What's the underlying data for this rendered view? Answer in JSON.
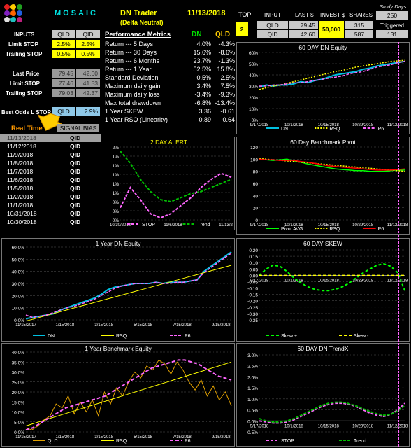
{
  "header": {
    "brand": "MOSAIC",
    "title": "DN Trader",
    "subtitle": "(Delta Neutral)",
    "date": "11/13/2018",
    "top_label": "TOP",
    "top_value": "2",
    "input_label": "INPUT",
    "last_label": "LAST $",
    "invest_label": "INVEST $",
    "shares_label": "SHARES",
    "study_days_label": "Study Days",
    "study_days_value": "250",
    "triggered_label": "Triggered",
    "triggered_value": "131",
    "row1": {
      "symbol": "QLD",
      "last": "79.45",
      "invest": "50,000",
      "shares": "315"
    },
    "row2": {
      "symbol": "QID",
      "last": "42.60",
      "shares": "587"
    }
  },
  "inputs": {
    "title": "INPUTS",
    "col1": "QLD",
    "col2": "QID",
    "rows": [
      {
        "label": "Limit STOP",
        "v1": "2.5%",
        "v2": "2.5%"
      },
      {
        "label": "Trailing STOP",
        "v1": "0.5%",
        "v2": "0.5%"
      },
      {
        "label": "Last Price",
        "v1": "79.45",
        "v2": "42.60"
      },
      {
        "label": "Limit STOP",
        "v1": "77.46",
        "v2": "41.53"
      },
      {
        "label": "Trailing STOP",
        "v1": "79.03",
        "v2": "42.37"
      }
    ],
    "best_odds_label": "Best Odds L STOP",
    "best_odds_symbol": "QLD",
    "best_odds_value": "2.9%",
    "realtime_label": "Real Time",
    "signal_bias_label": "SIGNAL BIAS"
  },
  "performance": {
    "title": "Performance Metrics",
    "col1": "DN",
    "col2": "QLD",
    "rows": [
      {
        "label": "Return --- 5 Days",
        "dn": "4.0%",
        "qld": "-4.3%"
      },
      {
        "label": "Return --- 30 Days",
        "dn": "15.6%",
        "qld": "-8.6%"
      },
      {
        "label": "Return --- 6 Months",
        "dn": "23.7%",
        "qld": "-1.3%"
      },
      {
        "label": "Return --- 1 Year",
        "dn": "52.5%",
        "qld": "15.8%"
      },
      {
        "label": "Standard Deviation",
        "dn": "0.5%",
        "qld": "2.5%"
      },
      {
        "label": "Maximum daily gain",
        "dn": "3.4%",
        "qld": "7.5%"
      },
      {
        "label": "Maximum daily loss",
        "dn": "-3.4%",
        "qld": "-9.3%"
      },
      {
        "label": "Max total drawdown",
        "dn": "-6.8%",
        "qld": "-13.4%"
      },
      {
        "label": "1 Year SKEW",
        "dn": "3.36",
        "qld": "-0.61"
      },
      {
        "label": "1 Year RSQ  (Linearity)",
        "dn": "0.89",
        "qld": "0.64"
      }
    ]
  },
  "history": [
    {
      "date": "11/13/2018",
      "sym": "QID"
    },
    {
      "date": "11/12/2018",
      "sym": "QID"
    },
    {
      "date": "11/9/2018",
      "sym": "QID"
    },
    {
      "date": "11/8/2018",
      "sym": "QID"
    },
    {
      "date": "11/7/2018",
      "sym": "QID"
    },
    {
      "date": "11/6/2018",
      "sym": "QID"
    },
    {
      "date": "11/5/2018",
      "sym": "QID"
    },
    {
      "date": "11/2/2018",
      "sym": "QID"
    },
    {
      "date": "11/1/2018",
      "sym": "QID"
    },
    {
      "date": "10/31/2018",
      "sym": "QID"
    },
    {
      "date": "10/30/2018",
      "sym": "QID"
    }
  ],
  "colors": {
    "green": "#00ff00",
    "cyan": "#00c0e0",
    "dark_green": "#00c000",
    "yellow": "#ffff00",
    "magenta": "#ff66ff",
    "red": "#ff0000",
    "orange": "#e0a000"
  },
  "chart_data": [
    {
      "type": "line",
      "title": "60 DAY DN  Equity",
      "ylim": [
        0,
        60
      ],
      "yticks": [
        "0%",
        "10%",
        "20%",
        "30%",
        "40%",
        "50%",
        "60%"
      ],
      "xticks": [
        "9/17/2018",
        "10/1/2018",
        "10/15/2018",
        "10/29/2018",
        "11/12/2018"
      ],
      "legend": [
        "DN",
        "RSQ",
        "P6"
      ],
      "series": [
        {
          "name": "DN",
          "values": [
            29,
            31,
            30,
            31,
            31,
            32,
            34,
            33,
            35,
            36,
            38,
            40,
            41,
            42,
            43,
            45,
            46,
            48,
            49,
            50,
            51,
            52
          ]
        },
        {
          "name": "RSQ",
          "values": [
            27,
            28.5,
            30,
            31,
            32.5,
            34,
            35.5,
            37,
            38.5,
            40,
            41.5,
            43,
            44,
            45.5,
            47,
            48,
            49,
            50,
            51,
            52,
            52.5,
            53
          ]
        },
        {
          "name": "P6",
          "values": [
            30,
            30,
            31,
            31,
            32,
            33,
            33,
            34,
            35,
            36,
            37,
            38,
            39,
            41,
            42,
            43,
            45,
            47,
            48,
            49,
            51,
            52
          ]
        }
      ]
    },
    {
      "type": "line",
      "title": "2 DAY ALERT",
      "ylim": [
        0,
        1.8
      ],
      "yticks": [
        "0%",
        "0%",
        "0%",
        "1%",
        "1%",
        "1%",
        "1%",
        "1%",
        "2%"
      ],
      "xticks": [
        "10/30/2018",
        "11/6/2018",
        "11/13/2"
      ],
      "legend": [
        "STOP",
        "Trend"
      ],
      "series": [
        {
          "name": "Trend",
          "values": [
            1.7,
            1.4,
            1.0,
            0.7,
            0.5,
            0.45,
            0.55,
            0.65,
            0.7,
            0.8,
            0.9,
            1.0
          ]
        },
        {
          "name": "STOP",
          "values": [
            0.3,
            0.8,
            0.5,
            0.15,
            0.05,
            0.15,
            0.35,
            0.55,
            0.8,
            1.0,
            1.15,
            1.05
          ]
        }
      ]
    },
    {
      "type": "line",
      "title": "60  Day  Benchmark Pivot",
      "ylim": [
        0,
        120
      ],
      "yticks": [
        "0",
        "20",
        "40",
        "60",
        "80",
        "100",
        "120"
      ],
      "xticks": [
        "9/17/2018",
        "10/1/2018",
        "10/15/2018",
        "10/29/2018",
        "11/12/2018"
      ],
      "legend": [
        "Pivot AVG",
        "RSQ",
        "P6"
      ],
      "series": [
        {
          "name": "Pivot AVG",
          "values": [
            100,
            99,
            98,
            99,
            100,
            97,
            95,
            92,
            90,
            88,
            86,
            84,
            83,
            82,
            81,
            81,
            80,
            80,
            80,
            81,
            82,
            82
          ]
        },
        {
          "name": "RSQ",
          "values": [
            101,
            100,
            99,
            98,
            97,
            96,
            95,
            94,
            93,
            92,
            91,
            90,
            89,
            88,
            87,
            86,
            85,
            84,
            83,
            82,
            81,
            80
          ]
        },
        {
          "name": "P6",
          "values": [
            100,
            99,
            99,
            98,
            98,
            98,
            96,
            95,
            93,
            91,
            89,
            88,
            87,
            86,
            85,
            84,
            83,
            82,
            82,
            82,
            83,
            84
          ]
        }
      ]
    },
    {
      "type": "line",
      "title": "1 Year  DN   Equity",
      "ylim": [
        0,
        60
      ],
      "yticks": [
        "0.0%",
        "10.0%",
        "20.0%",
        "30.0%",
        "40.0%",
        "50.0%",
        "60.0%"
      ],
      "xticks": [
        "11/15/2017",
        "1/15/2018",
        "3/15/2018",
        "5/15/2018",
        "7/15/2018",
        "9/15/2018"
      ],
      "legend": [
        "DN",
        "RSQ",
        "P6"
      ],
      "series": [
        {
          "name": "DN",
          "values": [
            1,
            2,
            3,
            4,
            5,
            8,
            10,
            12,
            14,
            16,
            18,
            21,
            25,
            27,
            28,
            29,
            30,
            30,
            30,
            31,
            30,
            31,
            31,
            31,
            32,
            33,
            40,
            44,
            48,
            52,
            56
          ]
        },
        {
          "name": "RSQ",
          "values": [
            -1,
            1,
            3,
            5,
            7,
            9,
            11,
            13,
            15,
            17,
            19,
            21,
            23,
            25,
            27,
            29,
            31,
            33,
            35,
            37,
            39,
            41,
            43,
            45
          ]
        },
        {
          "name": "P6",
          "values": [
            4,
            2,
            3,
            4,
            6,
            8,
            10,
            11,
            13,
            15,
            17,
            20,
            23,
            26,
            28,
            29,
            30,
            30,
            30,
            31,
            30,
            30,
            31,
            31,
            32,
            33,
            39,
            43,
            47,
            51,
            55
          ]
        }
      ]
    },
    {
      "type": "line",
      "title": "60  DAY  SKEW",
      "ylim": [
        -0.35,
        0.2
      ],
      "yticks": [
        "-0.35",
        "-0.30",
        "-0.25",
        "-0.20",
        "-0.15",
        "-0.10",
        "-0.05",
        "0.00",
        "0.05",
        "0.10",
        "0.15",
        "0.20"
      ],
      "xticks": [
        "9/17/2018",
        "10/1/2018",
        "10/15/2018",
        "10/29/2018",
        "11/12/2018"
      ],
      "legend": [
        "Skew +",
        "Skew -"
      ],
      "series": [
        {
          "name": "Skew +",
          "values": [
            0,
            0.05,
            0.08,
            0.07,
            0.03,
            -0.02,
            -0.06,
            -0.09,
            -0.11,
            -0.12,
            -0.12,
            -0.11,
            -0.09,
            -0.06,
            -0.02,
            0.02,
            0.05,
            0.08,
            0.09,
            0.07,
            0.02,
            -0.12
          ]
        },
        {
          "name": "Skew -",
          "values": [
            0,
            0,
            0,
            0,
            0,
            0,
            0,
            0,
            0,
            0,
            0,
            0,
            0,
            0,
            0,
            0,
            0,
            0,
            0,
            0,
            0,
            0
          ]
        }
      ]
    },
    {
      "type": "line",
      "title": "1 Year  Benchmark Equity",
      "ylim": [
        0,
        40
      ],
      "yticks": [
        "0.0%",
        "5.0%",
        "10.0%",
        "15.0%",
        "20.0%",
        "25.0%",
        "30.0%",
        "35.0%",
        "40.0%"
      ],
      "xticks": [
        "11/15/2017",
        "1/15/2018",
        "3/15/2018",
        "5/15/2018",
        "7/15/2018",
        "9/15/2018"
      ],
      "legend": [
        "QLD",
        "RSQ",
        "P6"
      ],
      "series": [
        {
          "name": "QLD",
          "values": [
            2,
            1,
            3,
            6,
            8,
            14,
            12,
            18,
            9,
            15,
            10,
            16,
            8,
            20,
            14,
            22,
            18,
            25,
            30,
            27,
            33,
            31,
            36,
            34,
            29,
            35,
            31,
            25,
            21,
            26,
            18,
            23,
            16,
            20,
            13
          ]
        },
        {
          "name": "RSQ",
          "values": [
            3,
            4,
            5,
            6,
            7,
            8,
            9,
            10,
            11,
            12,
            13,
            14,
            15,
            16,
            17,
            18,
            19,
            20,
            21,
            22,
            23,
            24,
            25,
            26,
            27,
            28,
            29,
            30,
            31,
            32,
            33,
            34,
            35
          ]
        },
        {
          "name": "P6",
          "values": [
            1,
            2,
            4,
            6,
            8,
            10,
            12,
            13,
            14,
            15,
            16,
            17,
            18,
            20,
            22,
            24,
            26,
            28,
            30,
            32,
            33,
            34,
            35,
            36,
            36,
            35,
            34,
            32,
            30,
            28,
            27,
            26
          ]
        }
      ]
    },
    {
      "type": "line",
      "title": "60  DAY  DN  TrendX",
      "ylim": [
        -0.5,
        3
      ],
      "yticks": [
        "-0.5%",
        "0.0%",
        "0.5%",
        "1.0%",
        "1.5%",
        "2.0%",
        "2.5%",
        "3.0%"
      ],
      "xticks": [
        "9/17/2018",
        "10/1/2018",
        "10/15/2018",
        "10/29/2018",
        "11/12/2018"
      ],
      "legend": [
        "STOP",
        "Trend"
      ],
      "series": [
        {
          "name": "STOP",
          "values": [
            0,
            -0.05,
            -0.1,
            -0.1,
            -0.05,
            0.05,
            0.2,
            0.35,
            0.5,
            0.65,
            0.75,
            0.8,
            0.8,
            0.75,
            0.65,
            0.5,
            0.35,
            0.25,
            0.2,
            0.3,
            0.5,
            0.8
          ]
        },
        {
          "name": "Trend",
          "values": [
            0.1,
            0,
            -0.05,
            -0.05,
            0,
            0.1,
            0.25,
            0.4,
            0.55,
            0.7,
            0.8,
            0.85,
            0.85,
            0.78,
            0.68,
            0.55,
            0.42,
            0.32,
            0.25,
            0.3,
            0.45,
            0.7
          ]
        }
      ]
    }
  ]
}
